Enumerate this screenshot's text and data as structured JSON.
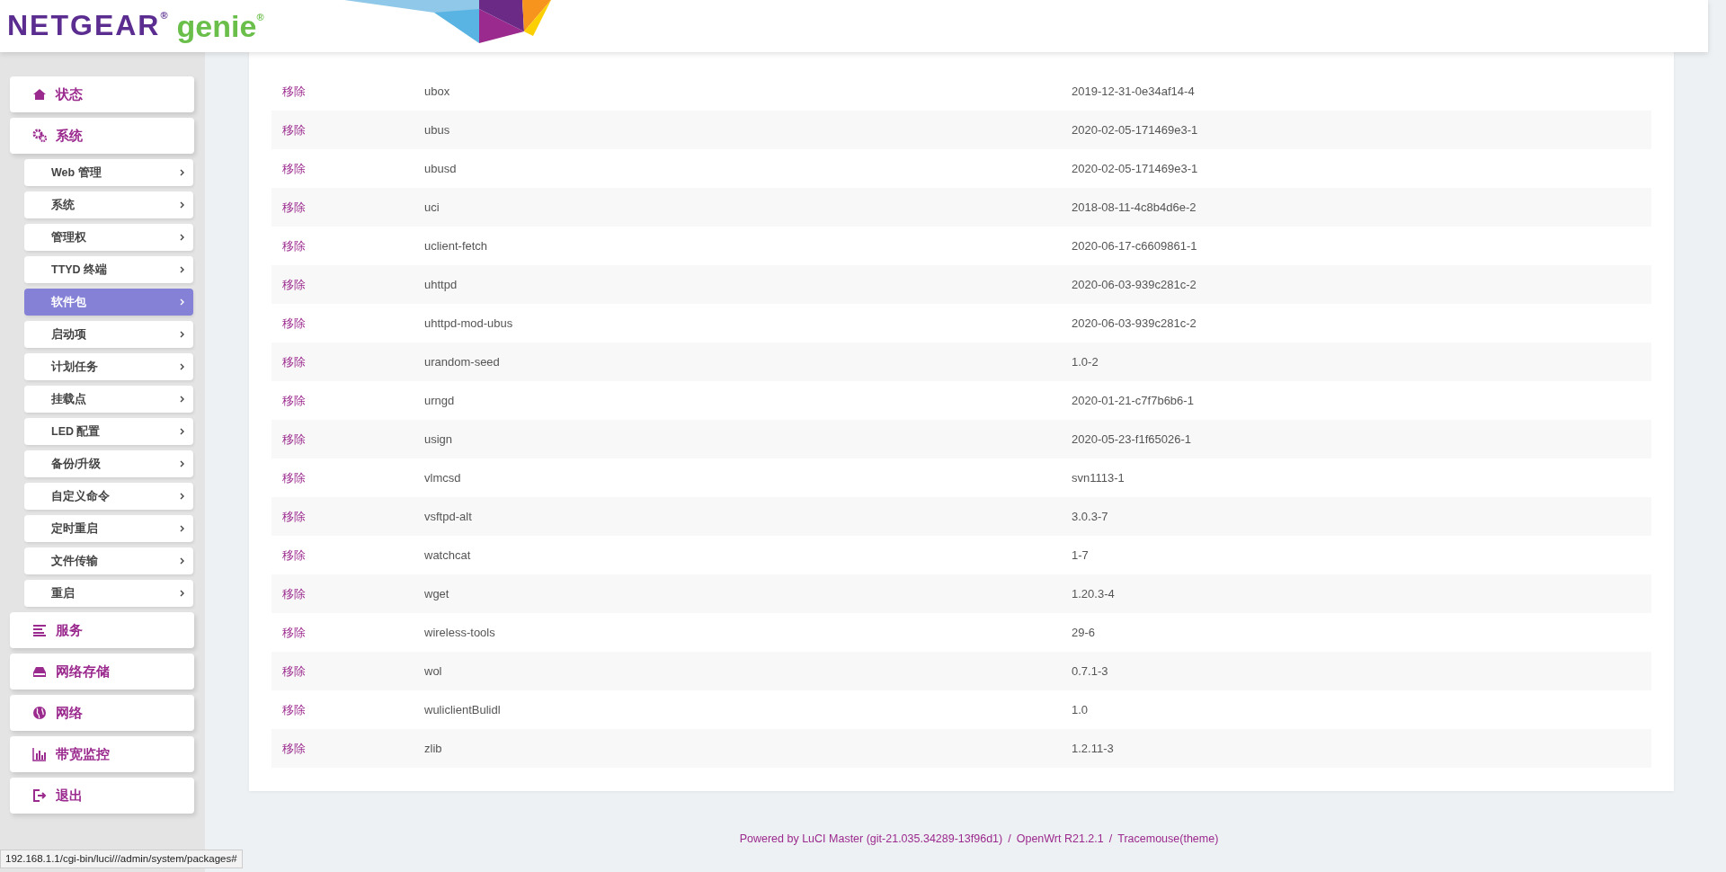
{
  "logo": {
    "brand": "NETGEAR$^{®}$",
    "product": "genie$^{®}$"
  },
  "sidebar": {
    "items": [
      {
        "kind": "top",
        "label": "状态"
      },
      {
        "kind": "top",
        "label": "系统",
        "children": [
          {
            "label": "Web 管理",
            "selected": false
          },
          {
            "label": "系统",
            "selected": false
          },
          {
            "label": "管理权",
            "selected": false
          },
          {
            "label": "TTYD 终端",
            "selected": false
          },
          {
            "label": "软件包",
            "selected": true
          },
          {
            "label": "启动项",
            "selected": false
          },
          {
            "label": "计划任务",
            "selected": false
          },
          {
            "label": "挂载点",
            "selected": false
          },
          {
            "label": "LED 配置",
            "selected": false
          },
          {
            "label": "备份/升级",
            "selected": false
          },
          {
            "label": "自定义命令",
            "selected": false
          },
          {
            "label": "定时重启",
            "selected": false
          },
          {
            "label": "文件传输",
            "selected": false
          },
          {
            "label": "重启",
            "selected": false
          }
        ]
      },
      {
        "kind": "top",
        "label": "服务"
      },
      {
        "kind": "top",
        "label": "网络存储"
      },
      {
        "kind": "top",
        "label": "网络"
      },
      {
        "kind": "top",
        "label": "带宽监控"
      },
      {
        "kind": "top",
        "label": "退出"
      }
    ]
  },
  "packages": {
    "rows": [
      {
        "action": "移除",
        "name": "ubox",
        "version": "2019-12-31-0e34af14-4"
      },
      {
        "action": "移除",
        "name": "ubus",
        "version": "2020-02-05-171469e3-1"
      },
      {
        "action": "移除",
        "name": "ubusd",
        "version": "2020-02-05-171469e3-1"
      },
      {
        "action": "移除",
        "name": "uci",
        "version": "2018-08-11-4c8b4d6e-2"
      },
      {
        "action": "移除",
        "name": "uclient-fetch",
        "version": "2020-06-17-c6609861-1"
      },
      {
        "action": "移除",
        "name": "uhttpd",
        "version": "2020-06-03-939c281c-2"
      },
      {
        "action": "移除",
        "name": "uhttpd-mod-ubus",
        "version": "2020-06-03-939c281c-2"
      },
      {
        "action": "移除",
        "name": "urandom-seed",
        "version": "1.0-2"
      },
      {
        "action": "移除",
        "name": "urngd",
        "version": "2020-01-21-c7f7b6b6-1"
      },
      {
        "action": "移除",
        "name": "usign",
        "version": "2020-05-23-f1f65026-1"
      },
      {
        "action": "移除",
        "name": "vlmcsd",
        "version": "svn1113-1"
      },
      {
        "action": "移除",
        "name": "vsftpd-alt",
        "version": "3.0.3-7"
      },
      {
        "action": "移除",
        "name": "watchcat",
        "version": "1-7"
      },
      {
        "action": "移除",
        "name": "wget",
        "version": "1.20.3-4"
      },
      {
        "action": "移除",
        "name": "wireless-tools",
        "version": "29-6"
      },
      {
        "action": "移除",
        "name": "wol",
        "version": "0.7.1-3"
      },
      {
        "action": "移除",
        "name": "wuliclientBulidl",
        "version": "1.0"
      },
      {
        "action": "移除",
        "name": "zlib",
        "version": "1.2.11-3"
      }
    ]
  },
  "footer": {
    "parts": [
      "Powered by LuCI Master (git-21.035.34289-13f96d1)",
      "/",
      "OpenWrt R21.2.1",
      "/",
      "Tracemouse(theme)"
    ]
  },
  "status_bar": {
    "url": "192.168.1.1/cgi-bin/luci///admin/system/packages#"
  }
}
